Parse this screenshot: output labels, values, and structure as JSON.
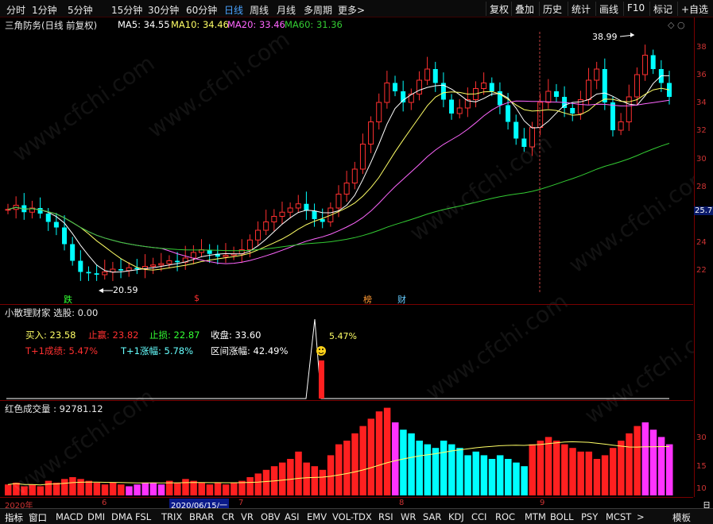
{
  "periods": [
    {
      "label": "分时",
      "active": false
    },
    {
      "label": "1分钟",
      "active": false
    },
    {
      "label": "5分钟",
      "active": false
    },
    {
      "label": "15分钟",
      "active": false
    },
    {
      "label": "30分钟",
      "active": false
    },
    {
      "label": "60分钟",
      "active": false
    },
    {
      "label": "日线",
      "active": true
    },
    {
      "label": "周线",
      "active": false
    },
    {
      "label": "月线",
      "active": false
    },
    {
      "label": "多周期",
      "active": false
    },
    {
      "label": "更多>",
      "active": false
    }
  ],
  "tools": [
    "复权",
    "叠加",
    "历史",
    "统计",
    "画线",
    "F10",
    "标记",
    "+自选"
  ],
  "main": {
    "title": "三角防务(日线 前复权)",
    "ma5": "MA5: 34.55",
    "ma10": "MA10: 34.46",
    "ma20": "MA20: 33.46",
    "ma60": "MA60: 31.36",
    "high_label": "38.99",
    "low_label": "20.59",
    "marks": [
      "跌",
      "$",
      "榜",
      "财"
    ],
    "axis_labels": [
      "38",
      "36",
      "34",
      "32",
      "30",
      "28",
      "26",
      "24",
      "22"
    ],
    "price_tag": "25.7"
  },
  "indicator": {
    "title": "小散理财家 选股: 0.00",
    "buy": "买入: 23.58",
    "take_profit": "止赢: 23.82",
    "stop_loss": "止损: 22.87",
    "close": "收盘: 33.60",
    "t1_profit": "T+1成绩: 5.47%",
    "t1_gain": "T+1涨幅: 5.78%",
    "range_gain": "区间涨幅: 42.49%",
    "pct_label": "5.47%"
  },
  "volume": {
    "title": "红色成交量 : 92781.12",
    "axis_labels": [
      "30",
      "15",
      "10"
    ]
  },
  "dates": [
    "2020年",
    "6",
    "2020/06/15/一",
    "7",
    "8",
    "9",
    "日"
  ],
  "bottom_tabs": [
    "指标",
    "窗口",
    "MACD",
    "DMI",
    "DMA",
    "FSL",
    "TRIX",
    "BRAR",
    "CR",
    "VR",
    "OBV",
    "ASI",
    "EMV",
    "VOL-TDX",
    "RSI",
    "WR",
    "SAR",
    "KDJ",
    "CCI",
    "ROC",
    "MTM",
    "BOLL",
    "PSY",
    "MCST",
    ">",
    "模板"
  ],
  "watermark": "www.cfchi.com",
  "colors": {
    "up": "#ff3030",
    "down": "#00ffff",
    "ma5": "#ffffff",
    "ma10": "#ffff66",
    "ma20": "#ff66ff",
    "ma60": "#33cc33"
  }
}
